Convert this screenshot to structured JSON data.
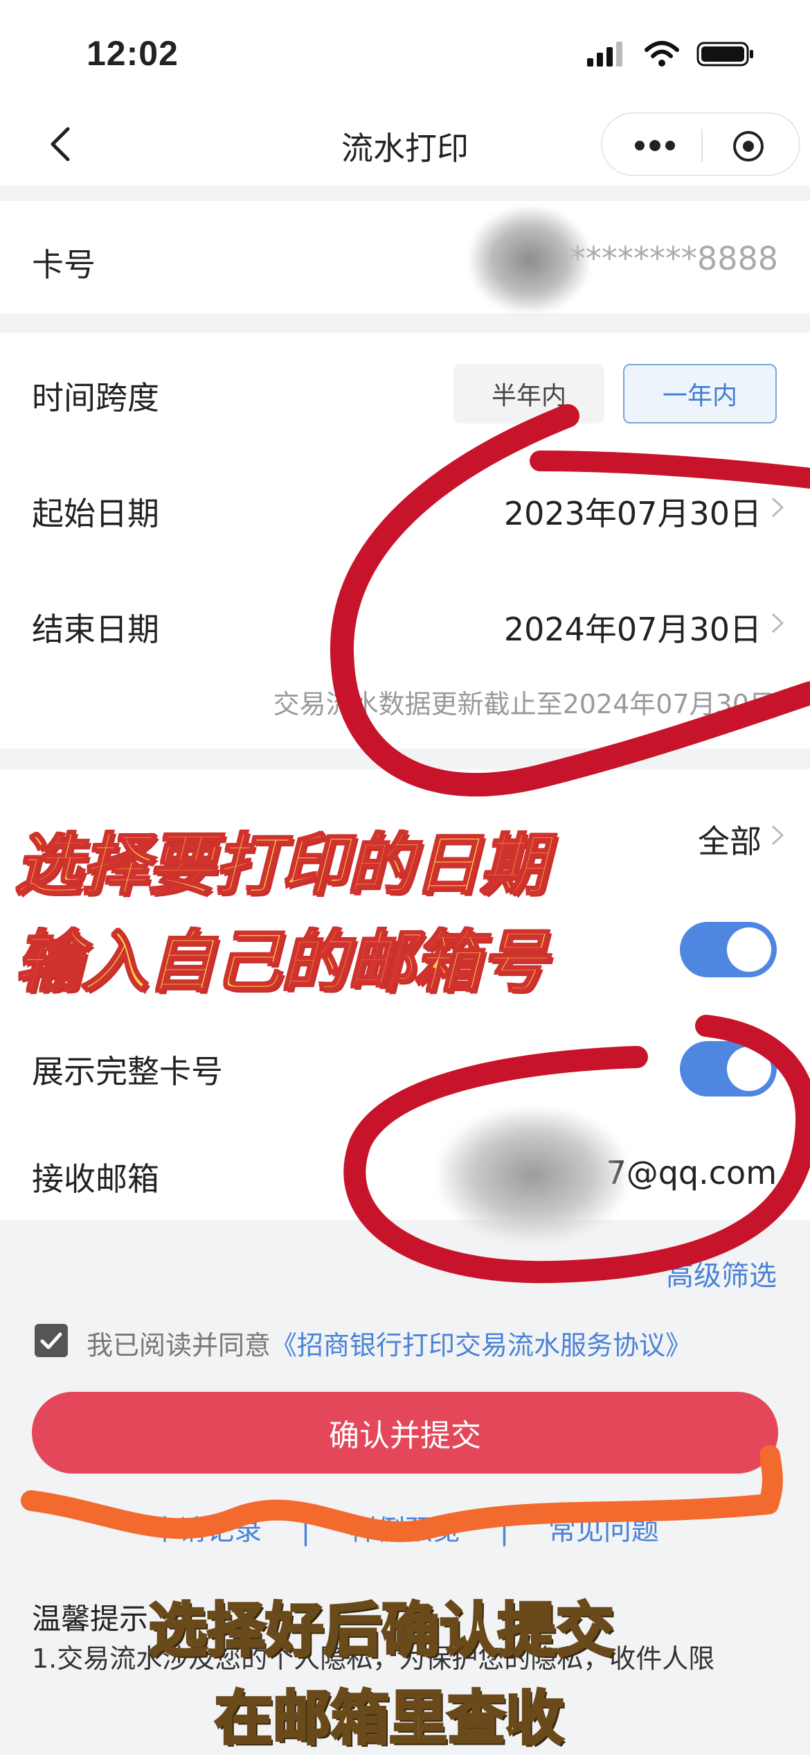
{
  "status_bar": {
    "time": "12:02"
  },
  "nav": {
    "title": "流水打印",
    "back_icon": "chevron-left-icon",
    "more_icon": "more-dots-icon",
    "target_icon": "target-icon"
  },
  "card": {
    "label": "卡号",
    "value_suffix": "6211********8888"
  },
  "time_span": {
    "label": "时间跨度",
    "options": [
      "半年内",
      "一年内"
    ],
    "selected": "一年内"
  },
  "start_date": {
    "label": "起始日期",
    "value": "2023年07月30日"
  },
  "end_date": {
    "label": "结束日期",
    "value": "2024年07月30日"
  },
  "update_note": "交易流水数据更新截止至2024年07月30日",
  "type_row": {
    "value": "全部"
  },
  "toggle_row_1": {
    "on": true
  },
  "show_full_card": {
    "label": "展示完整卡号",
    "on": true
  },
  "email": {
    "label": "接收邮箱",
    "value": "7@qq.com"
  },
  "advanced_filter": "高级筛选",
  "agreement": {
    "checked": true,
    "prefix": "我已阅读并同意",
    "link": "《招商银行打印交易流水服务协议》"
  },
  "submit": {
    "label": "确认并提交"
  },
  "bottom_links": [
    "申请记录",
    "样例预览",
    "常见问题"
  ],
  "bottom_separator": "|",
  "tips": {
    "title": "温馨提示",
    "line1": "1.交易流水涉及您的个人隐私，为保护您的隐私，收件人限"
  },
  "overlay": {
    "line1": "选择要打印的日期",
    "line2": "输入自己的邮箱号",
    "bottom1": "选择好后确认提交",
    "bottom2": "在邮箱里查收"
  },
  "colors": {
    "accent_red": "#e4475a",
    "link_blue": "#4a82d6",
    "toggle_blue": "#4f86e0",
    "annotation_red": "#c8142a",
    "annotation_orange": "#f26a2e"
  }
}
